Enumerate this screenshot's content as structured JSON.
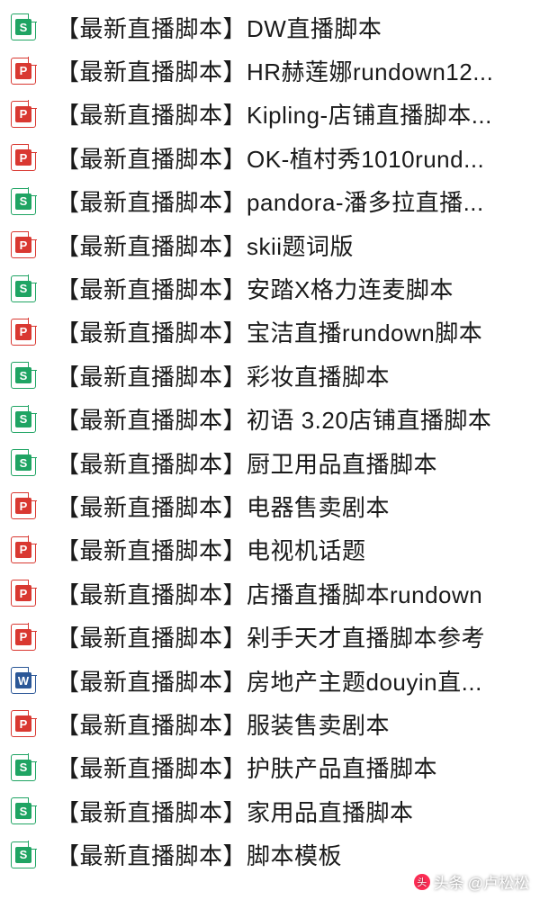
{
  "files": [
    {
      "type": "xls",
      "name": "【最新直播脚本】DW直播脚本"
    },
    {
      "type": "ppt",
      "name": "【最新直播脚本】HR赫莲娜rundown12..."
    },
    {
      "type": "ppt",
      "name": "【最新直播脚本】Kipling-店铺直播脚本..."
    },
    {
      "type": "ppt",
      "name": "【最新直播脚本】OK-植村秀1010rund..."
    },
    {
      "type": "xls",
      "name": "【最新直播脚本】pandora-潘多拉直播..."
    },
    {
      "type": "ppt",
      "name": "【最新直播脚本】skii题词版"
    },
    {
      "type": "xls",
      "name": "【最新直播脚本】安踏X格力连麦脚本"
    },
    {
      "type": "ppt",
      "name": "【最新直播脚本】宝洁直播rundown脚本"
    },
    {
      "type": "xls",
      "name": "【最新直播脚本】彩妆直播脚本"
    },
    {
      "type": "xls",
      "name": "【最新直播脚本】初语 3.20店铺直播脚本"
    },
    {
      "type": "xls",
      "name": "【最新直播脚本】厨卫用品直播脚本"
    },
    {
      "type": "ppt",
      "name": "【最新直播脚本】电器售卖剧本"
    },
    {
      "type": "ppt",
      "name": "【最新直播脚本】电视机话题"
    },
    {
      "type": "ppt",
      "name": "【最新直播脚本】店播直播脚本rundown"
    },
    {
      "type": "ppt",
      "name": "【最新直播脚本】剁手天才直播脚本参考"
    },
    {
      "type": "doc",
      "name": "【最新直播脚本】房地产主题douyin直..."
    },
    {
      "type": "ppt",
      "name": "【最新直播脚本】服装售卖剧本"
    },
    {
      "type": "xls",
      "name": "【最新直播脚本】护肤产品直播脚本"
    },
    {
      "type": "xls",
      "name": "【最新直播脚本】家用品直播脚本"
    },
    {
      "type": "xls",
      "name": "【最新直播脚本】脚本模板"
    }
  ],
  "iconLetters": {
    "xls": "S",
    "ppt": "P",
    "doc": "W"
  },
  "watermark": {
    "prefix": "头条",
    "handle": "@卢松松"
  }
}
